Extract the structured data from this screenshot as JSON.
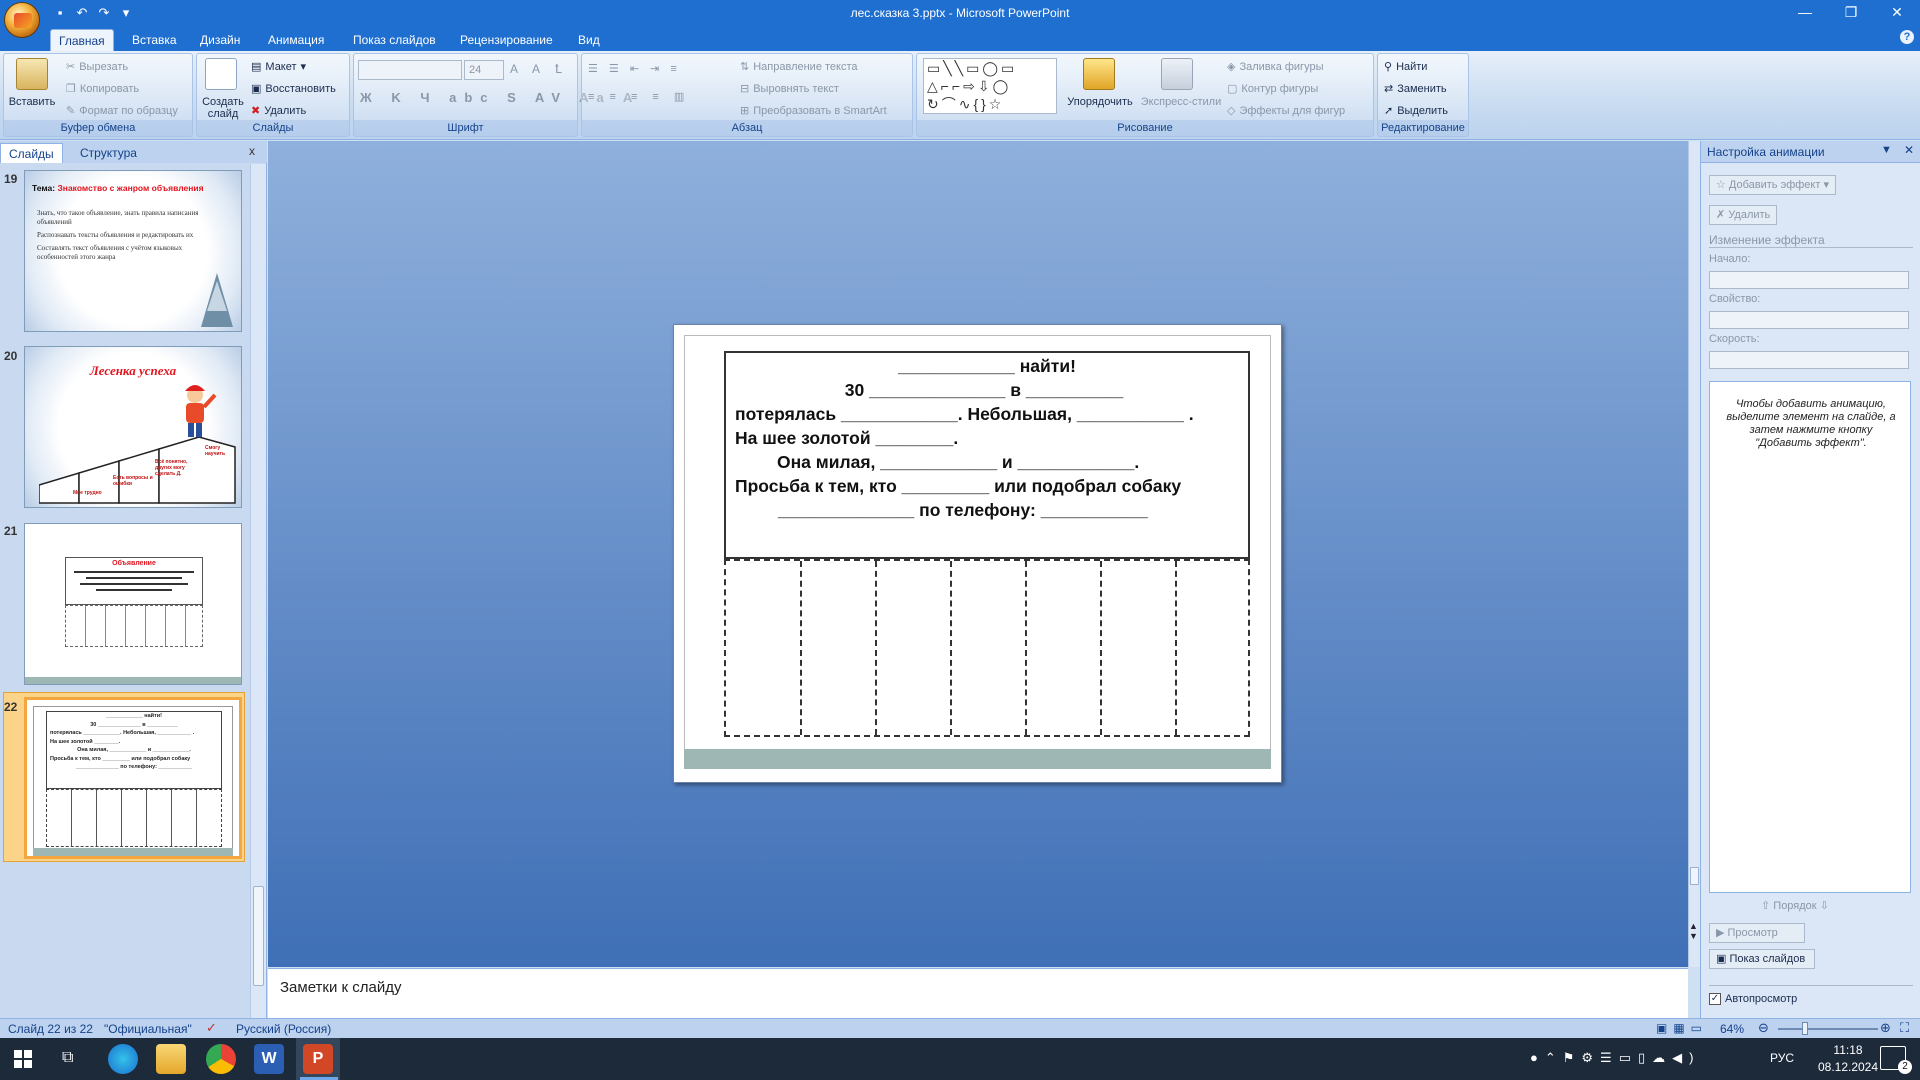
{
  "window": {
    "title": "лес.сказка 3.pptx  -  Microsoft PowerPoint"
  },
  "tabs": [
    "Главная",
    "Вставка",
    "Дизайн",
    "Анимация",
    "Показ слайдов",
    "Рецензирование",
    "Вид"
  ],
  "ribbon": {
    "clipboard": {
      "paste": "Вставить",
      "cut": "Вырезать",
      "copy": "Копировать",
      "format": "Формат по образцу",
      "label": "Буфер обмена"
    },
    "slides": {
      "new": "Создать слайд",
      "layout": "Макет",
      "reset": "Восстановить",
      "delete": "Удалить",
      "label": "Слайды"
    },
    "font": {
      "size": "24",
      "label": "Шрифт"
    },
    "paragraph": {
      "dir": "Направление текста",
      "align": "Выровнять текст",
      "smartart": "Преобразовать в SmartArt",
      "label": "Абзац"
    },
    "drawing": {
      "arrange": "Упорядочить",
      "styles": "Экспресс-стили",
      "fill": "Заливка фигуры",
      "outline": "Контур фигуры",
      "effects": "Эффекты для фигур",
      "label": "Рисование"
    },
    "editing": {
      "find": "Найти",
      "replace": "Заменить",
      "select": "Выделить",
      "label": "Редактирование"
    }
  },
  "leftpane": {
    "tab_slides": "Слайды",
    "tab_outline": "Структура",
    "close": "x"
  },
  "thumbs": {
    "n19": "19",
    "n20": "20",
    "n21": "21",
    "n22": "22",
    "t19_title_prefix": "Тема: ",
    "t19_title": "Знакомство с жанром объявления",
    "t19_b1": "Знать, что такое объявление, знать правила написания объявлений",
    "t19_b2": "Распознавать тексты объявления и редактировать их",
    "t19_b3": "Составлять текст объявления с учётом языковых особенностей этого жанра",
    "t20_title": "Лесенка успеха",
    "t20_s1": "Мне трудно",
    "t20_s2": "Есть вопросы и ошибки",
    "t20_s3": "Всё понятно, других могу сделать Д.",
    "t20_s4": "Смогу научить",
    "t21_title": "Объявление"
  },
  "slide": {
    "l1": "____________ найти!",
    "l2": "30 ______________ в __________",
    "l3": "потерялась ____________.   Небольшая, ___________ .",
    "l4": "На шее золотой  ________.",
    "l5": "Она милая,  ____________ и ____________.",
    "l6": "Просьба к тем, кто _________ или подобрал собаку",
    "l7": "______________ по телефону: ___________"
  },
  "notes": {
    "placeholder": "Заметки к слайду"
  },
  "anim": {
    "title": "Настройка анимации",
    "add": "Добавить эффект",
    "remove": "Удалить",
    "change": "Изменение эффекта",
    "start": "Начало:",
    "prop": "Свойство:",
    "speed": "Скорость:",
    "hint": "Чтобы добавить анимацию, выделите элемент на слайде, а затем нажмите кнопку \"Добавить эффект\".",
    "order": "Порядок",
    "preview": "Просмотр",
    "slideshow": "Показ слайдов",
    "autopreview": "Автопросмотр"
  },
  "status": {
    "slide": "Слайд 22 из 22",
    "theme": "\"Официальная\"",
    "lang": "Русский (Россия)",
    "zoom": "64%"
  },
  "taskbar": {
    "lang": "РУС",
    "time": "11:18",
    "date": "08.12.2024",
    "notif": "2"
  },
  "colors": {
    "titlebar": "#1f6fd0",
    "accent": "#f4a640",
    "red": "#e1141f"
  }
}
